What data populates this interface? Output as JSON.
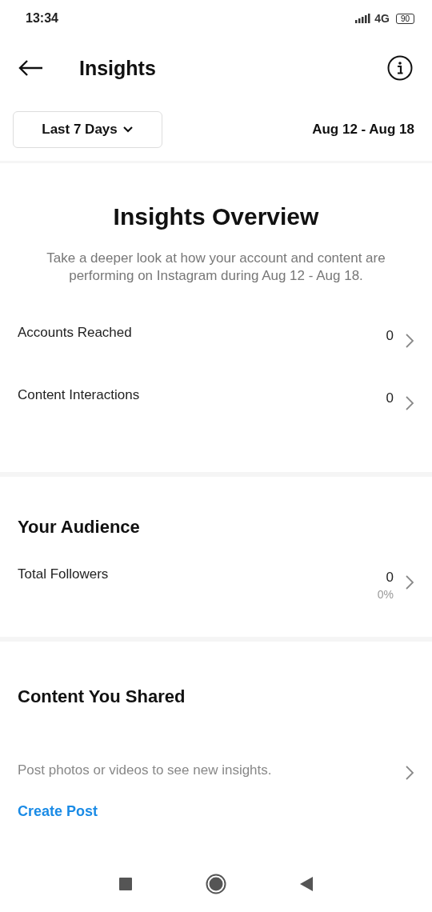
{
  "status_bar": {
    "time": "13:34",
    "network": "4G",
    "battery": "90"
  },
  "header": {
    "title": "Insights"
  },
  "filter": {
    "range": "Last 7 Days",
    "dates": "Aug 12 - Aug 18"
  },
  "overview": {
    "title": "Insights Overview",
    "description": "Take a deeper look at how your account and content are performing on Instagram during Aug 12 - Aug 18.",
    "rows": [
      {
        "label": "Accounts Reached",
        "value": "0"
      },
      {
        "label": "Content Interactions",
        "value": "0"
      }
    ]
  },
  "audience": {
    "title": "Your Audience",
    "rows": [
      {
        "label": "Total Followers",
        "value": "0",
        "change": "0%"
      }
    ]
  },
  "content": {
    "title": "Content You Shared",
    "message": "Post photos or videos to see new insights.",
    "link": "Create Post"
  }
}
